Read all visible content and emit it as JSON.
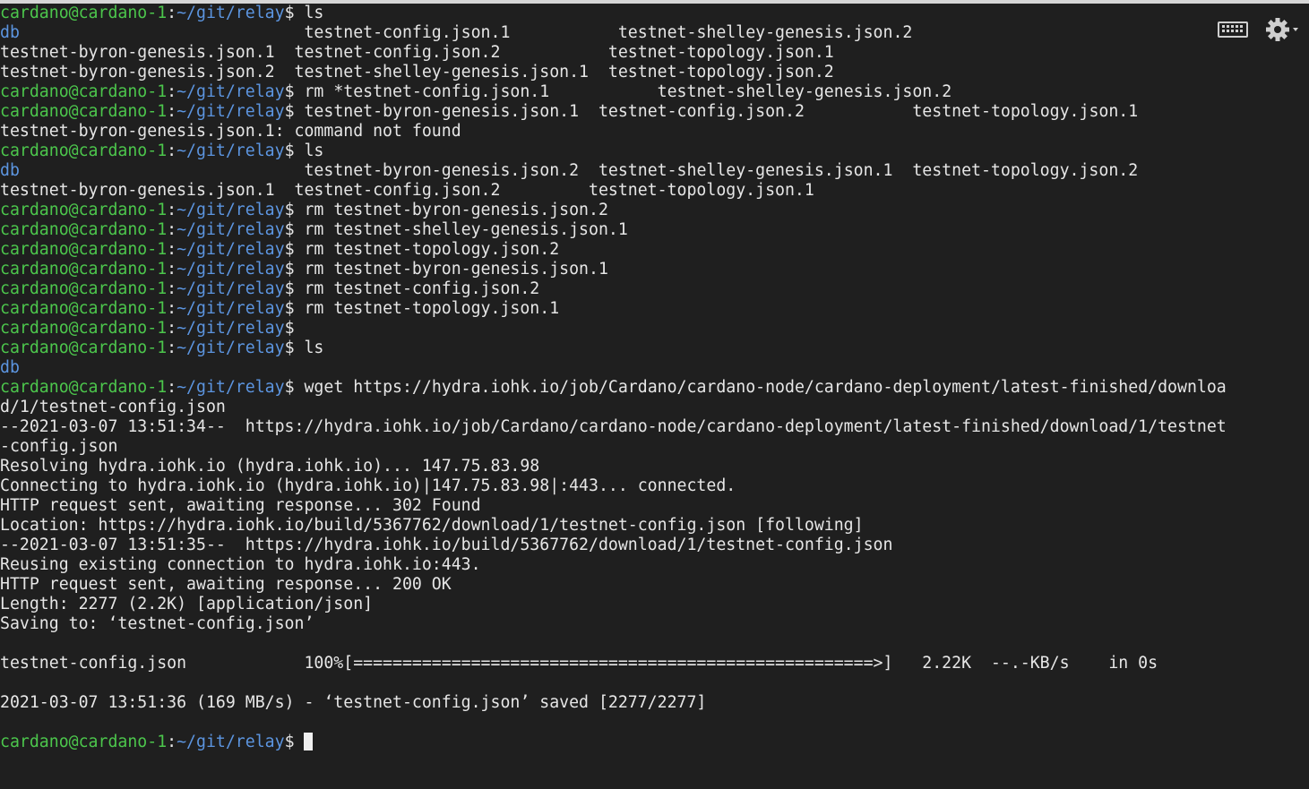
{
  "prompt": {
    "user": "cardano@cardano-1",
    "colon": ":",
    "path": "~/git/relay",
    "symbol": "$"
  },
  "lines": [
    {
      "prompt": true,
      "cmd": " ls"
    },
    {
      "segments": [
        {
          "text": "db",
          "kind": "dir"
        },
        {
          "text": "                             testnet-config.json.1           testnet-shelley-genesis.json.2",
          "kind": "plain"
        }
      ]
    },
    {
      "text": "testnet-byron-genesis.json.1  testnet-config.json.2           testnet-topology.json.1"
    },
    {
      "text": "testnet-byron-genesis.json.2  testnet-shelley-genesis.json.1  testnet-topology.json.2"
    },
    {
      "prompt": true,
      "cmd": " rm *testnet-config.json.1           testnet-shelley-genesis.json.2"
    },
    {
      "prompt": true,
      "cmd": " testnet-byron-genesis.json.1  testnet-config.json.2           testnet-topology.json.1"
    },
    {
      "text": "testnet-byron-genesis.json.1: command not found"
    },
    {
      "prompt": true,
      "cmd": " ls"
    },
    {
      "segments": [
        {
          "text": "db",
          "kind": "dir"
        },
        {
          "text": "                             testnet-byron-genesis.json.2  testnet-shelley-genesis.json.1  testnet-topology.json.2",
          "kind": "plain"
        }
      ]
    },
    {
      "text": "testnet-byron-genesis.json.1  testnet-config.json.2         testnet-topology.json.1"
    },
    {
      "prompt": true,
      "cmd": " rm testnet-byron-genesis.json.2"
    },
    {
      "prompt": true,
      "cmd": " rm testnet-shelley-genesis.json.1"
    },
    {
      "prompt": true,
      "cmd": " rm testnet-topology.json.2"
    },
    {
      "prompt": true,
      "cmd": " rm testnet-byron-genesis.json.1"
    },
    {
      "prompt": true,
      "cmd": " rm testnet-config.json.2"
    },
    {
      "prompt": true,
      "cmd": " rm testnet-topology.json.1"
    },
    {
      "prompt": true,
      "cmd": ""
    },
    {
      "prompt": true,
      "cmd": " ls"
    },
    {
      "segments": [
        {
          "text": "db",
          "kind": "dir"
        }
      ]
    },
    {
      "prompt": true,
      "cmd": " wget https://hydra.iohk.io/job/Cardano/cardano-node/cardano-deployment/latest-finished/downloa"
    },
    {
      "text": "d/1/testnet-config.json"
    },
    {
      "text": "--2021-03-07 13:51:34--  https://hydra.iohk.io/job/Cardano/cardano-node/cardano-deployment/latest-finished/download/1/testnet"
    },
    {
      "text": "-config.json"
    },
    {
      "text": "Resolving hydra.iohk.io (hydra.iohk.io)... 147.75.83.98"
    },
    {
      "text": "Connecting to hydra.iohk.io (hydra.iohk.io)|147.75.83.98|:443... connected."
    },
    {
      "text": "HTTP request sent, awaiting response... 302 Found"
    },
    {
      "text": "Location: https://hydra.iohk.io/build/5367762/download/1/testnet-config.json [following]"
    },
    {
      "text": "--2021-03-07 13:51:35--  https://hydra.iohk.io/build/5367762/download/1/testnet-config.json"
    },
    {
      "text": "Reusing existing connection to hydra.iohk.io:443."
    },
    {
      "text": "HTTP request sent, awaiting response... 200 OK"
    },
    {
      "text": "Length: 2277 (2.2K) [application/json]"
    },
    {
      "text": "Saving to: ‘testnet-config.json’"
    },
    {
      "text": ""
    },
    {
      "text": "testnet-config.json            100%[=====================================================>]   2.22K  --.-KB/s    in 0s"
    },
    {
      "text": ""
    },
    {
      "text": "2021-03-07 13:51:36 (169 MB/s) - ‘testnet-config.json’ saved [2277/2277]"
    },
    {
      "text": ""
    },
    {
      "prompt": true,
      "cmd": " ",
      "cursor": true
    }
  ],
  "toolbar": {
    "keyboard_icon": "keyboard-icon",
    "settings_icon": "gear-icon"
  },
  "colors": {
    "background": "#1f1f1f",
    "text": "#e6e6e6",
    "user": "#4cc64c",
    "path": "#5c95e0"
  }
}
